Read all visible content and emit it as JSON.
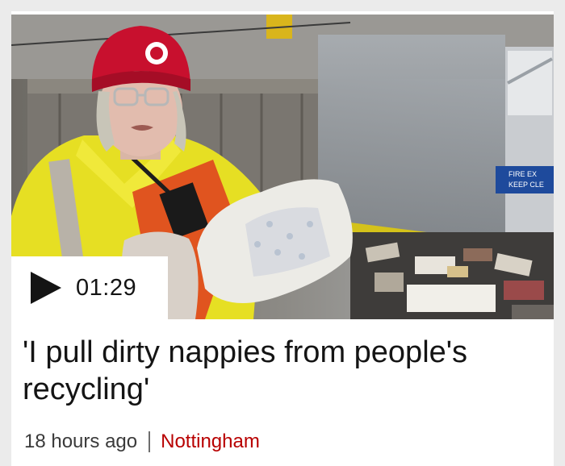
{
  "video": {
    "duration": "01:29",
    "sign_text": [
      "FIRE EX",
      "KEEP CLE"
    ]
  },
  "story": {
    "headline": "'I pull dirty nappies from people's recycling'",
    "time_ago": "18 hours ago",
    "location": "Nottingham"
  },
  "icons": {
    "play": "play-icon"
  },
  "colors": {
    "location_red": "#b80000",
    "hi_vis_yellow": "#e8e22a",
    "hat_red": "#c8102e"
  }
}
